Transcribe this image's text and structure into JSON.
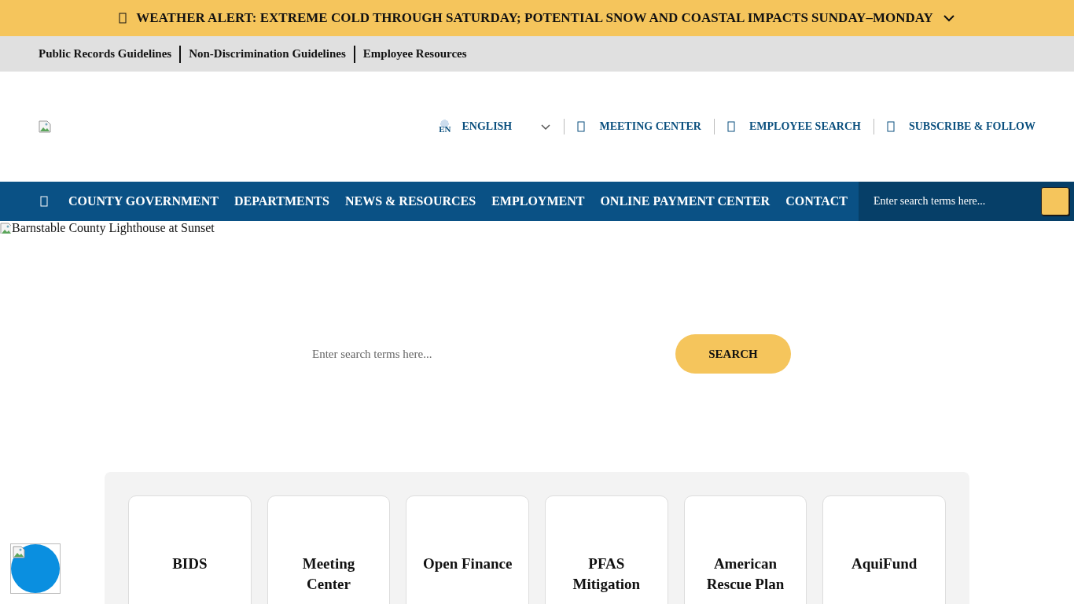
{
  "alert": {
    "text": "WEATHER ALERT: EXTREME COLD THROUGH SATURDAY; POTENTIAL SNOW AND COASTAL IMPACTS SUNDAY–MONDAY",
    "expanded": false
  },
  "utility_links": [
    "Public Records Guidelines",
    "Non-Discrimination Guidelines",
    "Employee Resources"
  ],
  "header": {
    "language": {
      "code": "EN",
      "label": "ENGLISH"
    },
    "links": [
      "MEETING CENTER",
      "EMPLOYEE SEARCH",
      "SUBSCRIBE & FOLLOW"
    ]
  },
  "nav": {
    "items": [
      "COUNTY GOVERNMENT",
      "DEPARTMENTS",
      "NEWS & RESOURCES",
      "EMPLOYMENT",
      "ONLINE PAYMENT CENTER",
      "CONTACT"
    ],
    "search_placeholder": "Enter search terms here..."
  },
  "hero": {
    "image_alt": "Barnstable County Lighthouse at Sunset",
    "search_placeholder": "Enter search terms here...",
    "search_button": "SEARCH"
  },
  "quick_links": [
    "BIDS",
    "Meeting Center",
    "Open Finance",
    "PFAS Mitigation",
    "American Rescue Plan",
    "AquiFund"
  ]
}
